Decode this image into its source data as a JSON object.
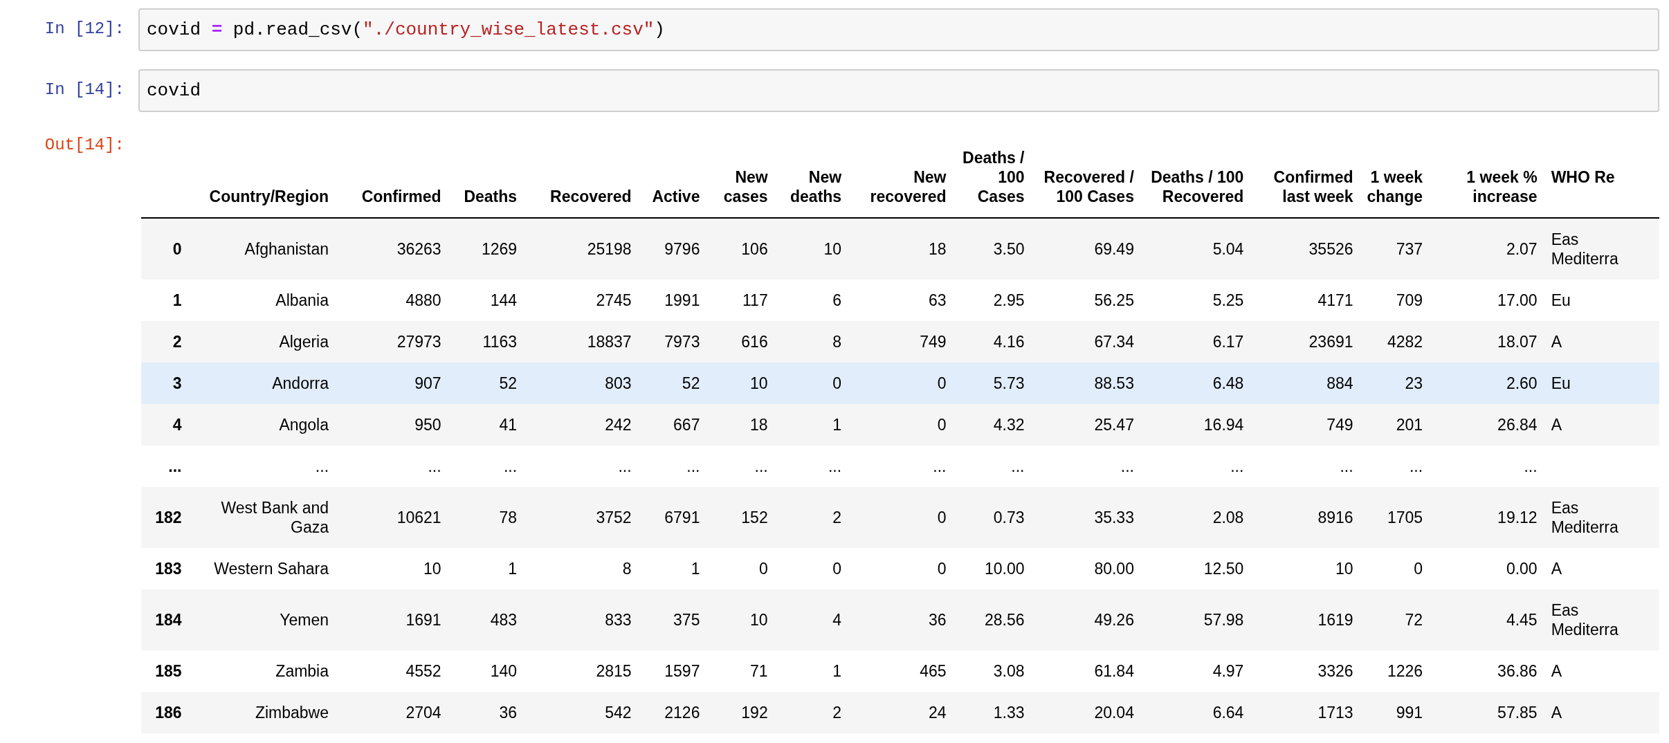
{
  "cells": [
    {
      "prompt": "In [12]:",
      "code": [
        {
          "kind": "name",
          "text": "covid "
        },
        {
          "kind": "operator",
          "text": "="
        },
        {
          "kind": "plain",
          "text": " pd.read_csv("
        },
        {
          "kind": "string",
          "text": "\"./country_wise_latest.csv\""
        },
        {
          "kind": "plain",
          "text": ")"
        }
      ]
    },
    {
      "prompt": "In [14]:",
      "code": [
        {
          "kind": "name",
          "text": "covid"
        }
      ]
    }
  ],
  "output": {
    "prompt": "Out[14]:",
    "table": {
      "columns": [
        "Country/Region",
        "Confirmed",
        "Deaths",
        "Recovered",
        "Active",
        "New cases",
        "New deaths",
        "New recovered",
        "Deaths / 100 Cases",
        "Recovered / 100 Cases",
        "Deaths / 100 Recovered",
        "Confirmed last week",
        "1 week change",
        "1 week % increase",
        "WHO Re"
      ],
      "rows": [
        {
          "index": "0",
          "hovered": false,
          "cells": [
            "Afghanistan",
            "36263",
            "1269",
            "25198",
            "9796",
            "106",
            "10",
            "18",
            "3.50",
            "69.49",
            "5.04",
            "35526",
            "737",
            "2.07",
            "Eas\nMediterra"
          ]
        },
        {
          "index": "1",
          "hovered": false,
          "cells": [
            "Albania",
            "4880",
            "144",
            "2745",
            "1991",
            "117",
            "6",
            "63",
            "2.95",
            "56.25",
            "5.25",
            "4171",
            "709",
            "17.00",
            "Eu"
          ]
        },
        {
          "index": "2",
          "hovered": false,
          "cells": [
            "Algeria",
            "27973",
            "1163",
            "18837",
            "7973",
            "616",
            "8",
            "749",
            "4.16",
            "67.34",
            "6.17",
            "23691",
            "4282",
            "18.07",
            "A"
          ]
        },
        {
          "index": "3",
          "hovered": true,
          "cells": [
            "Andorra",
            "907",
            "52",
            "803",
            "52",
            "10",
            "0",
            "0",
            "5.73",
            "88.53",
            "6.48",
            "884",
            "23",
            "2.60",
            "Eu"
          ]
        },
        {
          "index": "4",
          "hovered": false,
          "cells": [
            "Angola",
            "950",
            "41",
            "242",
            "667",
            "18",
            "1",
            "0",
            "4.32",
            "25.47",
            "16.94",
            "749",
            "201",
            "26.84",
            "A"
          ]
        },
        {
          "index": "...",
          "hovered": false,
          "cells": [
            "...",
            "...",
            "...",
            "...",
            "...",
            "...",
            "...",
            "...",
            "...",
            "...",
            "...",
            "...",
            "...",
            "..."
          ]
        },
        {
          "index": "182",
          "hovered": false,
          "cells": [
            "West Bank and Gaza",
            "10621",
            "78",
            "3752",
            "6791",
            "152",
            "2",
            "0",
            "0.73",
            "35.33",
            "2.08",
            "8916",
            "1705",
            "19.12",
            "Eas\nMediterra"
          ]
        },
        {
          "index": "183",
          "hovered": false,
          "cells": [
            "Western Sahara",
            "10",
            "1",
            "8",
            "1",
            "0",
            "0",
            "0",
            "10.00",
            "80.00",
            "12.50",
            "10",
            "0",
            "0.00",
            "A"
          ]
        },
        {
          "index": "184",
          "hovered": false,
          "cells": [
            "Yemen",
            "1691",
            "483",
            "833",
            "375",
            "10",
            "4",
            "36",
            "28.56",
            "49.26",
            "57.98",
            "1619",
            "72",
            "4.45",
            "Eas\nMediterra"
          ]
        },
        {
          "index": "185",
          "hovered": false,
          "cells": [
            "Zambia",
            "4552",
            "140",
            "2815",
            "1597",
            "71",
            "1",
            "465",
            "3.08",
            "61.84",
            "4.97",
            "3326",
            "1226",
            "36.86",
            "A"
          ]
        },
        {
          "index": "186",
          "hovered": false,
          "cells": [
            "Zimbabwe",
            "2704",
            "36",
            "542",
            "2126",
            "192",
            "2",
            "24",
            "1.33",
            "20.04",
            "6.64",
            "1713",
            "991",
            "57.85",
            "A"
          ]
        }
      ]
    }
  }
}
